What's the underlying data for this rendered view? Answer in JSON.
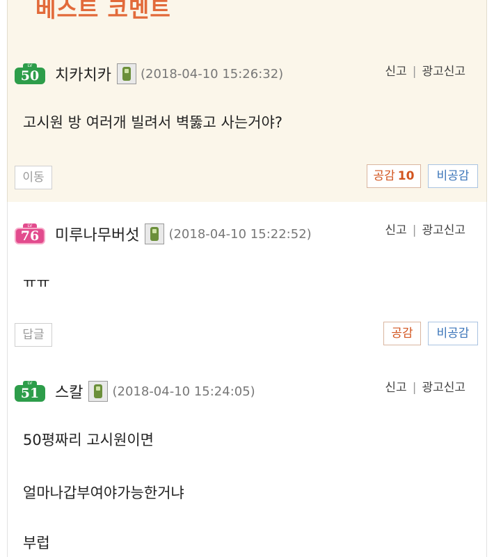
{
  "best_header": {
    "title": "베스트 코멘트"
  },
  "comments": [
    {
      "level": "50",
      "nickname": "치카치카",
      "timestamp": "(2018-04-10 15:26:32)",
      "report": "신고",
      "ad_report": "광고신고",
      "lines": [
        "고시원 방 여러개 빌려서 벽뚫고 사는거야?"
      ],
      "left_button": "이동",
      "like_label": "공감",
      "like_count": "10",
      "dislike_label": "비공감"
    },
    {
      "level": "76",
      "nickname": "미루나무버섯",
      "timestamp": "(2018-04-10 15:22:52)",
      "report": "신고",
      "ad_report": "광고신고",
      "lines": [
        "ㅠㅠ"
      ],
      "left_button": "답글",
      "like_label": "공감",
      "dislike_label": "비공감"
    },
    {
      "level": "51",
      "nickname": "스칼",
      "timestamp": "(2018-04-10 15:24:05)",
      "report": "신고",
      "ad_report": "광고신고",
      "lines": [
        "50평짜리 고시원이면",
        "얼마나갑부여야가능한거냐",
        "부럽"
      ]
    }
  ],
  "colors": {
    "best_bg": "#fbf6ea",
    "level_green": "#2d9d4a",
    "level_pink": "#e24b8d",
    "like": "#d2541e",
    "dislike": "#3a74b9"
  },
  "icons": {
    "level_badge": "level-badge-icon",
    "mobile": "mobile-phone-icon"
  }
}
